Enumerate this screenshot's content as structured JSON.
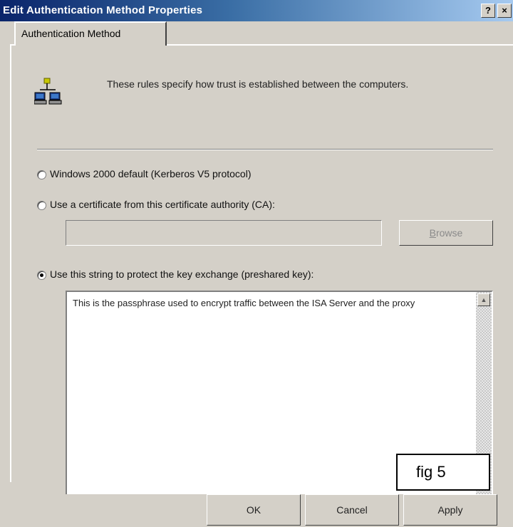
{
  "window": {
    "title": "Edit Authentication Method Properties",
    "help_glyph": "?",
    "close_glyph": "×"
  },
  "tab": {
    "label": "Authentication Method"
  },
  "description": "These rules specify how trust is established between the computers.",
  "options": [
    {
      "label": "Windows 2000 default (Kerberos V5 protocol)",
      "selected": false
    },
    {
      "label": "Use a certificate from this certificate authority (CA):",
      "selected": false
    },
    {
      "label": "Use this string to protect the key exchange (preshared key):",
      "selected": true
    }
  ],
  "certificate_field": {
    "value": ""
  },
  "browse_button": {
    "label_mnemonic": "B",
    "label_rest": "rowse"
  },
  "preshared_key": {
    "value": "This is the passphrase used to encrypt traffic between the ISA Server and the proxy"
  },
  "scrollbar": {
    "up_icon": "scroll-up-arrow"
  },
  "figure_label": "fig 5",
  "buttons": {
    "ok": "OK",
    "cancel": "Cancel",
    "apply": "Apply"
  }
}
